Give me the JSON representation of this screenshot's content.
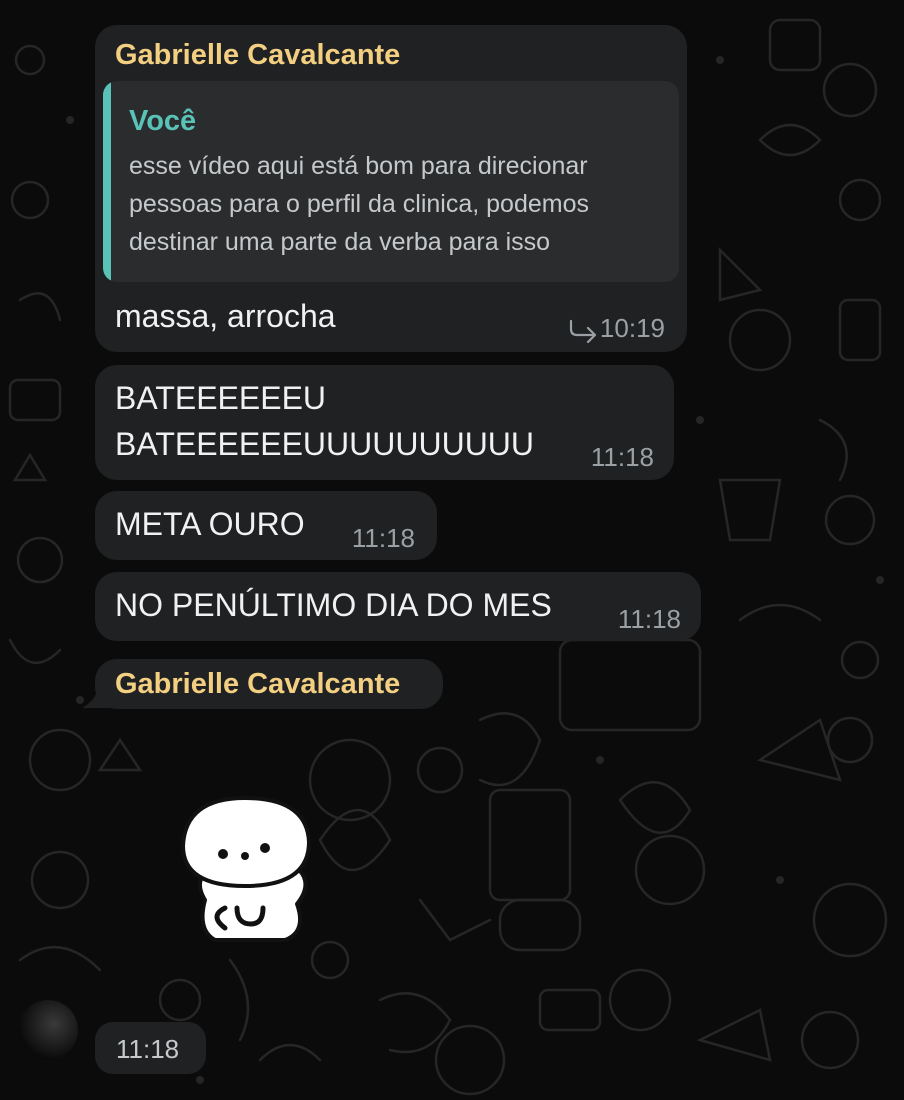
{
  "chat": {
    "quoted_message": {
      "sender": "Gabrielle Cavalcante",
      "quote_author": "Você",
      "quote_text": "esse vídeo aqui está bom para direcionar pessoas para o perfil da clinica, podemos destinar uma parte da verba para isso",
      "text": "massa, arrocha",
      "time": "10:19"
    },
    "messages": [
      {
        "line1": "BATEEEEEEU",
        "line2": "BATEEEEEEUUUUUUUUUU",
        "time": "11:18"
      },
      {
        "text": "META OURO",
        "time": "11:18"
      },
      {
        "text": "NO PENÚLTIMO DIA DO MES",
        "time": "11:18"
      }
    ],
    "sticker_message": {
      "sender": "Gabrielle Cavalcante",
      "time": "11:18"
    }
  },
  "colors": {
    "background": "#0b0b0b",
    "bubble": "#1f2123",
    "sender_name": "#f3cf82",
    "quote_accent": "#5ac3b8",
    "timestamp": "#9aa0a3"
  }
}
